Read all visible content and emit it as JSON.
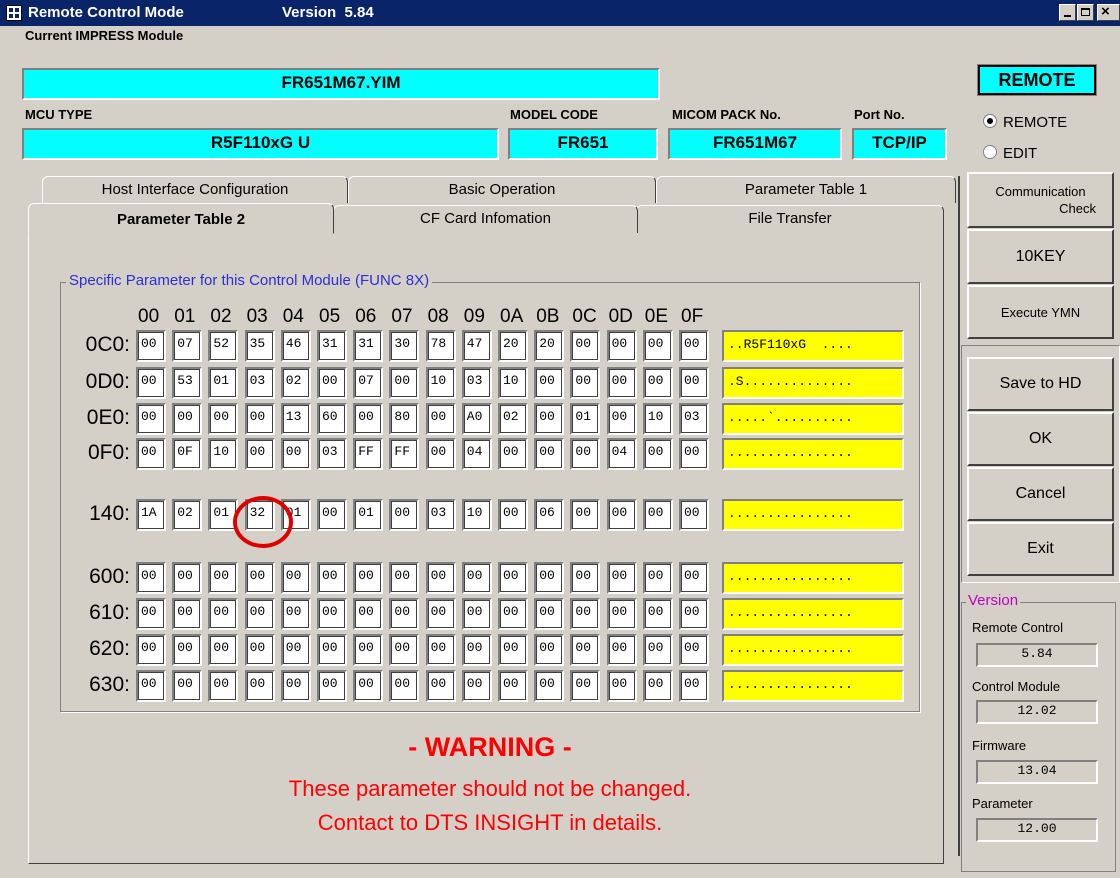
{
  "window": {
    "title": "Remote Control Mode",
    "version_label": "Version  5.84"
  },
  "module": {
    "label": "Current IMPRESS Module",
    "value": "FR651M67.YIM"
  },
  "mcu": {
    "label": "MCU TYPE",
    "value": "R5F110xG U"
  },
  "model_code": {
    "label": "MODEL CODE",
    "value": "FR651"
  },
  "micom_pack": {
    "label": "MICOM PACK No.",
    "value": "FR651M67"
  },
  "port": {
    "label": "Port No.",
    "value": "TCP/IP"
  },
  "mode": {
    "status": "REMOTE",
    "options": [
      "REMOTE",
      "EDIT"
    ],
    "selected": "REMOTE"
  },
  "tabs": {
    "back_row": [
      "Host Interface Configuration",
      "Basic Operation",
      "Parameter Table 1"
    ],
    "front_row": [
      "Parameter Table 2",
      "CF Card Infomation",
      "File Transfer"
    ],
    "active": "Parameter Table 2"
  },
  "group_title": "Specific Parameter for this Control Module (FUNC 8X)",
  "columns": [
    "00",
    "01",
    "02",
    "03",
    "04",
    "05",
    "06",
    "07",
    "08",
    "09",
    "0A",
    "0B",
    "0C",
    "0D",
    "0E",
    "0F"
  ],
  "rows": [
    {
      "addr": "0C0:",
      "cells": [
        "00",
        "07",
        "52",
        "35",
        "46",
        "31",
        "31",
        "30",
        "78",
        "47",
        "20",
        "20",
        "00",
        "00",
        "00",
        "00"
      ],
      "ascii": "..R5F110xG  ...."
    },
    {
      "addr": "0D0:",
      "cells": [
        "00",
        "53",
        "01",
        "03",
        "02",
        "00",
        "07",
        "00",
        "10",
        "03",
        "10",
        "00",
        "00",
        "00",
        "00",
        "00"
      ],
      "ascii": ".S.............."
    },
    {
      "addr": "0E0:",
      "cells": [
        "00",
        "00",
        "00",
        "00",
        "13",
        "60",
        "00",
        "80",
        "00",
        "A0",
        "02",
        "00",
        "01",
        "00",
        "10",
        "03"
      ],
      "ascii": ".....`.........."
    },
    {
      "addr": "0F0:",
      "cells": [
        "00",
        "0F",
        "10",
        "00",
        "00",
        "03",
        "FF",
        "FF",
        "00",
        "04",
        "00",
        "00",
        "00",
        "04",
        "00",
        "00"
      ],
      "ascii": "................"
    },
    {
      "addr": "140:",
      "cells": [
        "1A",
        "02",
        "01",
        "32",
        "01",
        "00",
        "01",
        "00",
        "03",
        "10",
        "00",
        "06",
        "00",
        "00",
        "00",
        "00"
      ],
      "ascii": "................"
    },
    {
      "addr": "600:",
      "cells": [
        "00",
        "00",
        "00",
        "00",
        "00",
        "00",
        "00",
        "00",
        "00",
        "00",
        "00",
        "00",
        "00",
        "00",
        "00",
        "00"
      ],
      "ascii": "................"
    },
    {
      "addr": "610:",
      "cells": [
        "00",
        "00",
        "00",
        "00",
        "00",
        "00",
        "00",
        "00",
        "00",
        "00",
        "00",
        "00",
        "00",
        "00",
        "00",
        "00"
      ],
      "ascii": "................"
    },
    {
      "addr": "620:",
      "cells": [
        "00",
        "00",
        "00",
        "00",
        "00",
        "00",
        "00",
        "00",
        "00",
        "00",
        "00",
        "00",
        "00",
        "00",
        "00",
        "00"
      ],
      "ascii": "................"
    },
    {
      "addr": "630:",
      "cells": [
        "00",
        "00",
        "00",
        "00",
        "00",
        "00",
        "00",
        "00",
        "00",
        "00",
        "00",
        "00",
        "00",
        "00",
        "00",
        "00"
      ],
      "ascii": "................"
    }
  ],
  "warning": {
    "title": "- WARNING -",
    "line1": "These parameter should not be changed.",
    "line2": "Contact to DTS INSIGHT in details."
  },
  "side_buttons": {
    "comm_check_line1": "Communication",
    "comm_check_line2": "Check",
    "tenkey": "10KEY",
    "execute": "Execute YMN",
    "save": "Save to HD",
    "ok": "OK",
    "cancel": "Cancel",
    "exit": "Exit"
  },
  "version_group": {
    "title": "Version",
    "items": [
      {
        "label": "Remote Control",
        "value": "5.84"
      },
      {
        "label": "Control Module",
        "value": "12.02"
      },
      {
        "label": "Firmware",
        "value": "13.04"
      },
      {
        "label": "Parameter",
        "value": "12.00"
      }
    ]
  },
  "colors": {
    "field_cyan": "#00ffff",
    "ascii_yellow": "#ffff00",
    "warning_red": "#ff0000",
    "group_title_blue": "#2d2dd6",
    "version_title_magenta": "#c000c0",
    "title_bar": "#0a246a",
    "highlight_circle": "#e00000"
  }
}
